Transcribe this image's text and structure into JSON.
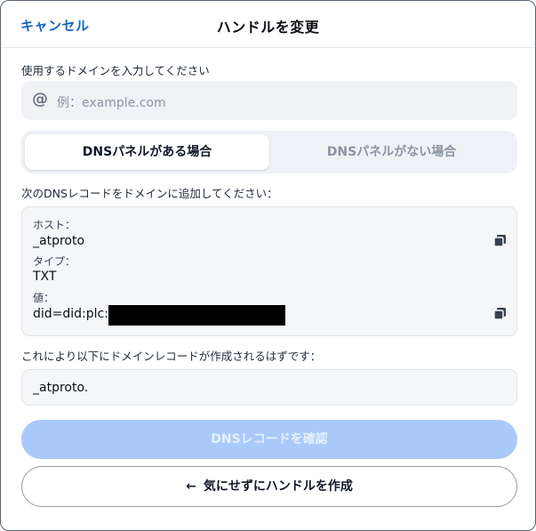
{
  "header": {
    "cancel_label": "キャンセル",
    "title": "ハンドルを変更"
  },
  "domain": {
    "label": "使用するドメインを入力してください",
    "placeholder": "例：example.com",
    "icon": "at-icon"
  },
  "tabs": [
    {
      "label": "DNSパネルがある場合",
      "active": true
    },
    {
      "label": "DNSパネルがない場合",
      "active": false
    }
  ],
  "instruction": "次のDNSレコードをドメインに追加してください：",
  "record": {
    "host_label": "ホスト：",
    "host_value": "_atproto",
    "type_label": "タイプ：",
    "type_value": "TXT",
    "value_label": "値：",
    "value_value": "did=did:plc:"
  },
  "result": {
    "label": "これにより以下にドメインレコードが作成されるはずです：",
    "value": "_atproto."
  },
  "buttons": {
    "verify": "DNSレコードを確認",
    "skip": "気にせずにハンドルを作成",
    "skip_icon": "←"
  },
  "colors": {
    "accent": "#1466c6",
    "primary_disabled": "#a9c9fb"
  }
}
